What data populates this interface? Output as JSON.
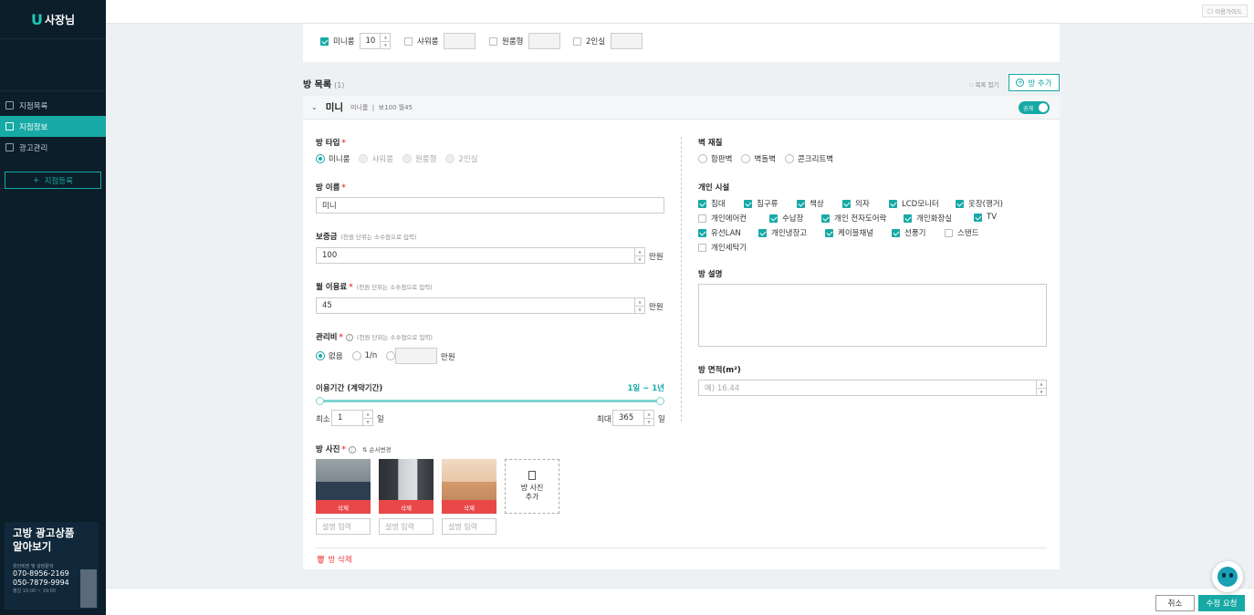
{
  "sidebar": {
    "logo_u": "U",
    "logo_text": "사장님",
    "nav": [
      {
        "label": "지점목록",
        "active": false
      },
      {
        "label": "지점정보",
        "active": true
      },
      {
        "label": "광고관리",
        "active": false
      }
    ],
    "register_label": "지점등록",
    "ad": {
      "title_line1": "고방 광고상품",
      "title_line2": "알아보기",
      "sub": "유인비전 및 상담문의",
      "phone1": "070-8956-2169",
      "phone2": "050-7879-9994",
      "hours": "평일 10:00 ~ 19:00"
    }
  },
  "topbar": {
    "guide_label": "이용가이드"
  },
  "room_types_top": [
    {
      "label": "미니룸",
      "checked": true,
      "count": "10"
    },
    {
      "label": "샤워룸",
      "checked": false,
      "count": ""
    },
    {
      "label": "원룸형",
      "checked": false,
      "count": ""
    },
    {
      "label": "2인실",
      "checked": false,
      "count": ""
    }
  ],
  "room_list": {
    "title": "방 목록",
    "count": "(1)",
    "collapse_label": "목록 접기",
    "add_label": "방 추가"
  },
  "room": {
    "name": "미니",
    "summary_type": "미니룸",
    "summary_price": "보100 월45",
    "public_label": "공개",
    "type_label": "방 타입",
    "types": [
      {
        "label": "미니룸",
        "selected": true
      },
      {
        "label": "샤워룸",
        "selected": false
      },
      {
        "label": "원룸형",
        "selected": false
      },
      {
        "label": "2인실",
        "selected": false
      }
    ],
    "name_label": "방 이름",
    "name_value": "미니",
    "deposit_label": "보증금",
    "deposit_hint": "(천원 단위는 소수점으로 입력)",
    "deposit_value": "100",
    "deposit_unit": "만원",
    "monthly_label": "월 이용료",
    "monthly_hint": "(천원 단위는 소수점으로 입력)",
    "monthly_value": "45",
    "monthly_unit": "만원",
    "fee_label": "관리비",
    "fee_hint": "(천원 단위는 소수점으로 입력)",
    "fee_options": [
      "없음",
      "1/n"
    ],
    "fee_unit": "만원",
    "period_label": "이용기간 (계약기간)",
    "period_value": "1일 ~ 1년",
    "period_fraction_start": 0,
    "period_fraction_end": 1,
    "min_label": "최소",
    "min_value": "1",
    "max_label": "최대",
    "max_value": "365",
    "day_unit": "일",
    "photo_label": "방 사진",
    "order_label": "순서변경",
    "delete_photo_label": "삭제",
    "add_photo_label1": "방 사진",
    "add_photo_label2": "추가",
    "desc_placeholder": "설명 입력",
    "delete_room_label": "방 삭제",
    "wall_label": "벽 재질",
    "walls": [
      "합판벽",
      "벽돌벽",
      "콘크리트벽"
    ],
    "facility_label": "개인 시설",
    "facilities": [
      {
        "label": "침대",
        "checked": true
      },
      {
        "label": "침구류",
        "checked": true
      },
      {
        "label": "책상",
        "checked": true
      },
      {
        "label": "의자",
        "checked": true
      },
      {
        "label": "LCD모니터",
        "checked": true
      },
      {
        "label": "옷장(행거)",
        "checked": true
      },
      {
        "label": "개인에어컨",
        "checked": false
      },
      {
        "label": "수납장",
        "checked": true
      },
      {
        "label": "개인 전자도어락",
        "checked": true
      },
      {
        "label": "개인화장실",
        "checked": true
      },
      {
        "label": "TV",
        "checked": true
      },
      {
        "label": "유선LAN",
        "checked": true
      },
      {
        "label": "개인냉장고",
        "checked": true
      },
      {
        "label": "케이블채널",
        "checked": true
      },
      {
        "label": "선풍기",
        "checked": true
      },
      {
        "label": "스탠드",
        "checked": false
      },
      {
        "label": "개인세탁기",
        "checked": false
      }
    ],
    "desc_label": "방 설명",
    "area_label": "방 면적(m²)",
    "area_placeholder": "예) 16.44"
  },
  "footer": {
    "cancel_label": "취소",
    "submit_label": "수정 요청"
  },
  "colors": {
    "accent": "#17a9a5",
    "danger": "#e94848",
    "sidebar": "#0b1e2a"
  }
}
